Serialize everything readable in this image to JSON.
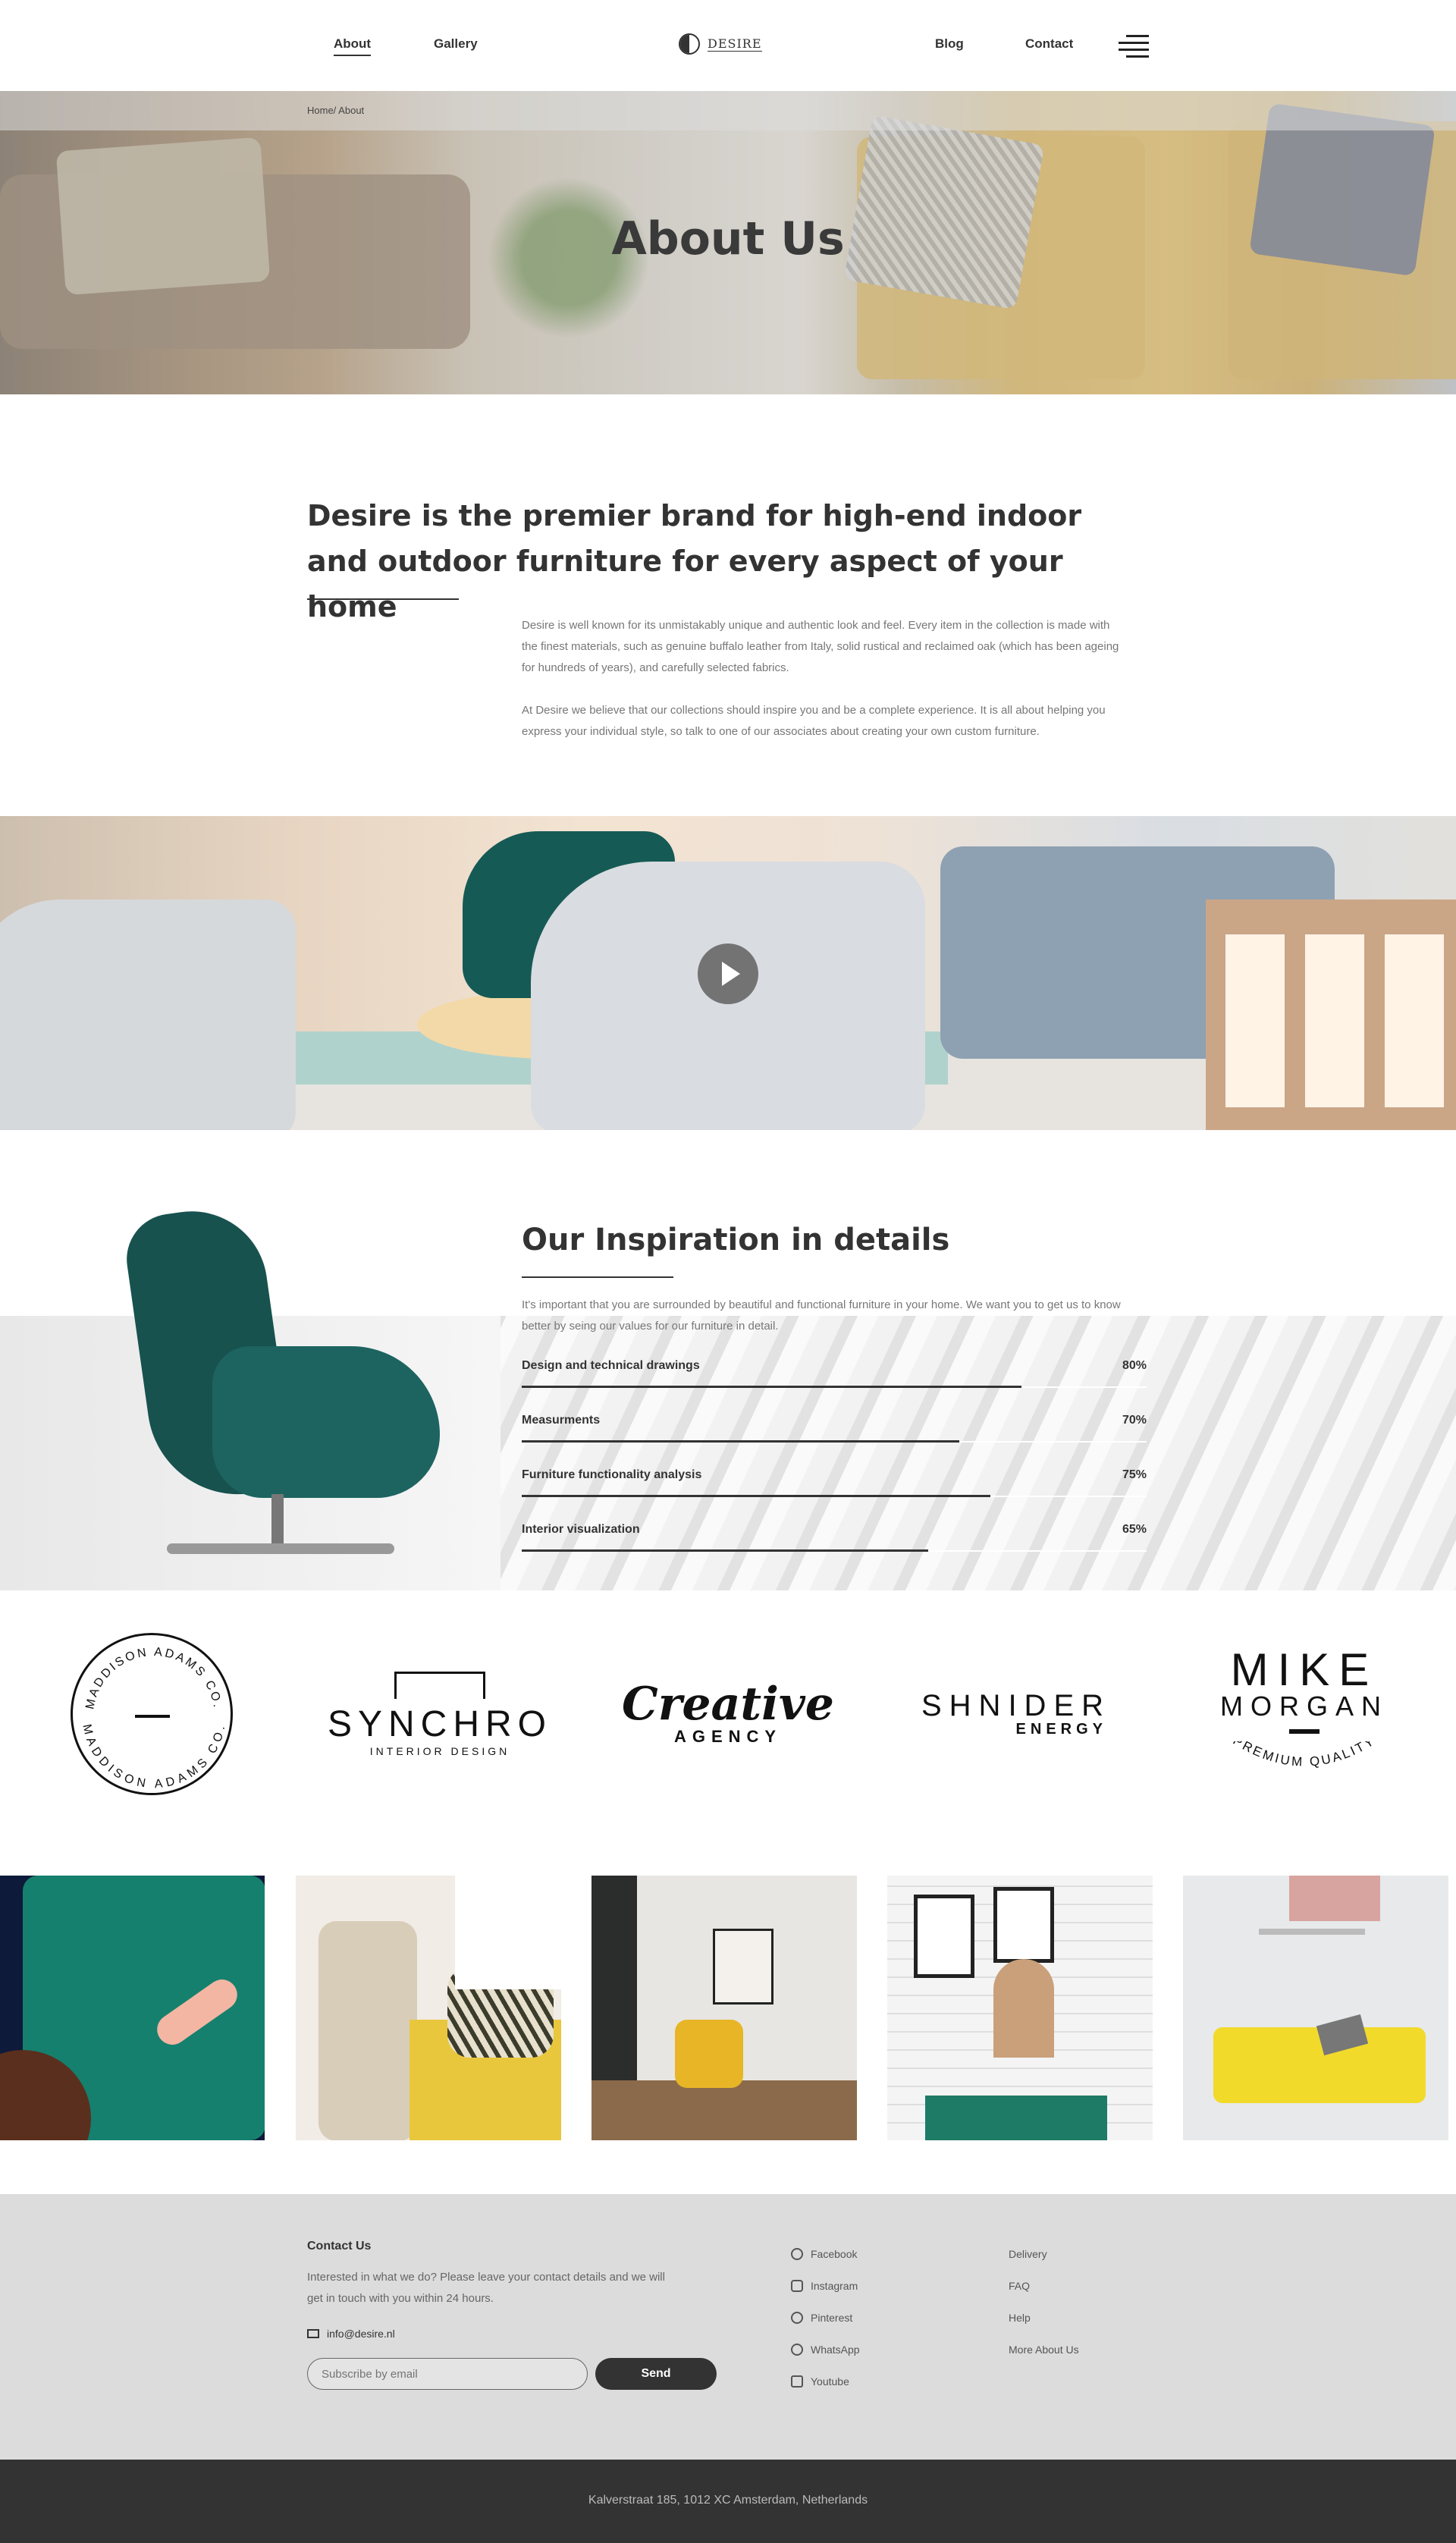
{
  "nav": {
    "items": [
      {
        "label": "About",
        "active": true
      },
      {
        "label": "Gallery",
        "active": false
      },
      {
        "label": "Blog",
        "active": false
      },
      {
        "label": "Contact",
        "active": false
      }
    ],
    "logo_text": "DESIRE",
    "menu_icon": "hamburger-icon"
  },
  "hero": {
    "breadcrumb": "Home/ About",
    "title": "About Us"
  },
  "intro": {
    "heading": "Desire is the premier brand for high-end indoor and outdoor furniture for every aspect of your home",
    "paragraph1": "Desire is well known for its unmistakably unique and authentic look and feel. Every item in the collection is made with the finest materials, such as genuine buffalo leather from Italy, solid rustical and reclaimed oak (which has been ageing for hundreds of years), and carefully selected fabrics.",
    "paragraph2": "At Desire we believe that our collections should inspire you and be a complete experience. It is all about helping you express your individual style, so talk to one of our associates about creating your own custom furniture."
  },
  "video": {
    "play_icon": "play-icon"
  },
  "inspiration": {
    "title": "Our Inspiration in details",
    "paragraph": "It's important that you are surrounded by beautiful and functional furniture in your home. We want you to get us to know better by seing our values for our furniture in detail.",
    "skills": [
      {
        "label": "Design and technical drawings",
        "pct_label": "80%",
        "value": 0.8
      },
      {
        "label": "Measurments",
        "pct_label": "70%",
        "value": 0.7
      },
      {
        "label": "Furniture functionality analysis",
        "pct_label": "75%",
        "value": 0.75
      },
      {
        "label": "Interior visualization",
        "pct_label": "65%",
        "value": 0.65
      }
    ]
  },
  "brands": [
    {
      "name": "MADDISON ADAMS CO."
    },
    {
      "name": "SYNCHRO",
      "sub": "INTERIOR DESIGN"
    },
    {
      "name": "Creative",
      "sub": "AGENCY"
    },
    {
      "name": "SHNIDER",
      "sub": "ENERGY"
    },
    {
      "name": "MIKE",
      "name2": "MORGAN",
      "sub": "PREMIUM QUALITY"
    }
  ],
  "footer": {
    "contact_title": "Contact Us",
    "contact_text": "Interested in what we do? Please leave your contact details and we will get in touch with you within 24 hours.",
    "email": "info@desire.nl",
    "subscribe_placeholder": "Subscribe by email",
    "send_label": "Send",
    "social": [
      "Facebook",
      "Instagram",
      "Pinterest",
      "WhatsApp",
      "Youtube"
    ],
    "links": [
      "Delivery",
      "FAQ",
      "Help",
      "More About Us"
    ],
    "address": "Kalverstraat 185, 1012 XC Amsterdam, Netherlands"
  },
  "colors": {
    "dark": "#333333",
    "footer_bg": "#dcdcdc",
    "bottom_bar": "#333333"
  }
}
